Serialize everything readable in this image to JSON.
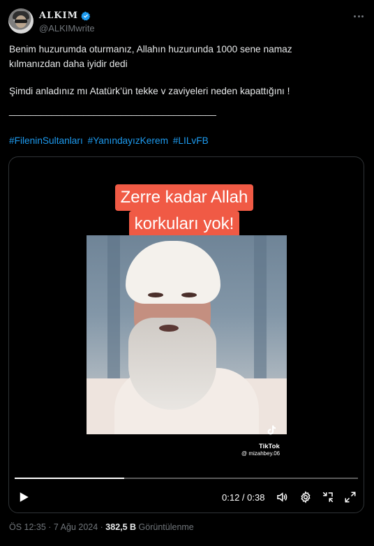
{
  "author": {
    "display_name": "ALKIM",
    "handle": "@ALKIMwrite",
    "verified": true
  },
  "tweet": {
    "text_line_1": "Benim huzurumda oturmanız, Allahın huzurunda 1000 sene namaz",
    "text_line_2": "kılmanızdan daha iyidir dedi",
    "text_line_3": "Şimdi anladınız mı Atatürk’ün tekke v zaviyeleri neden kapattığını !",
    "divider_line": "_______________________________________",
    "hashtags": [
      "#FileninSultanları",
      "#YanındayızKerem",
      "#LILvFB"
    ]
  },
  "video": {
    "caption_line_1": "Zerre kadar Allah",
    "caption_line_2": "korkuları yok!",
    "watermark_label": "TikTok",
    "watermark_user": "@ mizahbey.06",
    "progress_fraction": 0.32,
    "time_display": "0:12 / 0:38",
    "caption_color": "#f05a45"
  },
  "meta": {
    "timestamp": "ÖS 12:35 · 7 Ağu 2024 · ",
    "views_count": "382,5 B",
    "views_label": " Görüntülenme"
  },
  "colors": {
    "background": "#000000",
    "text": "#e7e9ea",
    "muted": "#71767b",
    "link": "#1d9bf0",
    "verified": "#1d9bf0"
  },
  "icons": [
    "verified-badge-icon",
    "more-icon",
    "play-icon",
    "volume-icon",
    "settings-icon",
    "fullscreen-exit-icon",
    "expand-icon",
    "tiktok-icon"
  ]
}
